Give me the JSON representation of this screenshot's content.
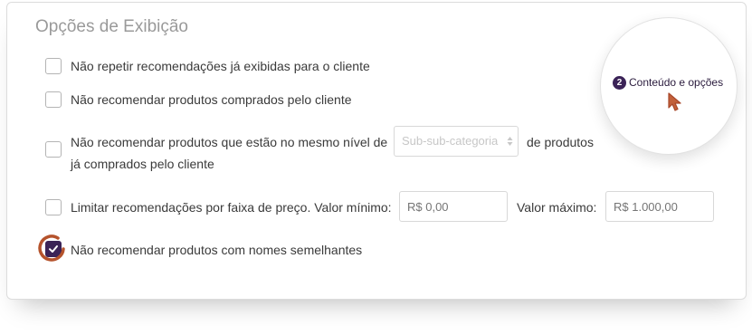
{
  "section": {
    "title": "Opções de Exibição"
  },
  "options": [
    {
      "label": "Não repetir recomendações já exibidas para o cliente",
      "checked": false
    },
    {
      "label": "Não recomendar produtos comprados pelo cliente",
      "checked": false
    },
    {
      "label_before": "Não recomendar produtos que estão no mesmo nível de",
      "select_value": "Sub-sub-categoria",
      "label_after": "de produtos",
      "label_line2": "já comprados pelo  cliente",
      "checked": false
    },
    {
      "label": "Limitar recomendações por faixa de preço. Valor mínimo:",
      "min_placeholder": "R$ 0,00",
      "max_label": "Valor máximo:",
      "max_placeholder": "R$ 1.000,00",
      "checked": false
    },
    {
      "label": "Não recomendar produtos com nomes semelhantes",
      "checked": true
    }
  ],
  "callout": {
    "badge": "2",
    "text": "Conteúdo e opções"
  },
  "colors": {
    "accent": "#3b2357",
    "annotation": "#b5532c"
  }
}
